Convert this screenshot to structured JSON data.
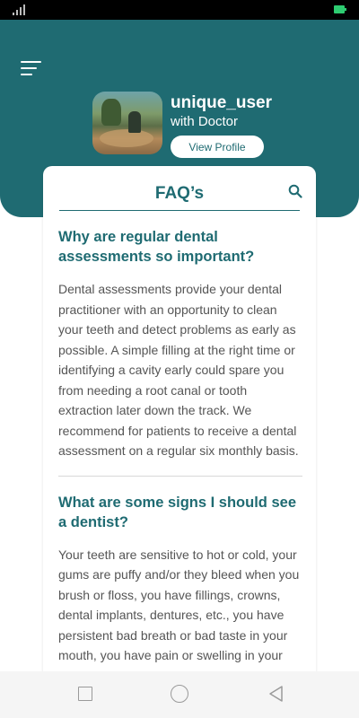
{
  "colors": {
    "primary": "#1f6b72",
    "status_bar": "#000000",
    "battery": "#2ecc71"
  },
  "profile": {
    "username": "unique_user",
    "subtitle": "with Doctor",
    "view_profile_label": "View Profile"
  },
  "faq": {
    "title": "FAQ’s",
    "items": [
      {
        "question": "Why are regular dental assessments so important?",
        "answer": "Dental assessments provide your dental practitioner with an opportunity to clean your teeth and detect problems as early as possible. A simple filling at the right time or identifying a cavity early could spare you from needing a root canal or tooth extraction later down the track. We recommend for patients to receive a dental assessment on a regular six monthly basis."
      },
      {
        "question": "What are some signs I should see a dentist?",
        "answer": "Your teeth are sensitive to hot or cold, your gums are puffy and/or they bleed when you brush or floss, you have fillings, crowns, dental implants, dentures, etc., you have persistent bad breath or bad taste in your mouth, you have pain or swelling in your mouth, face or neck, you have difficulty chewing or swallowing"
      }
    ]
  },
  "icons": {
    "menu": "hamburger-menu-icon",
    "search": "search-icon",
    "nav_recent": "square-icon",
    "nav_home": "circle-icon",
    "nav_back": "triangle-back-icon"
  }
}
